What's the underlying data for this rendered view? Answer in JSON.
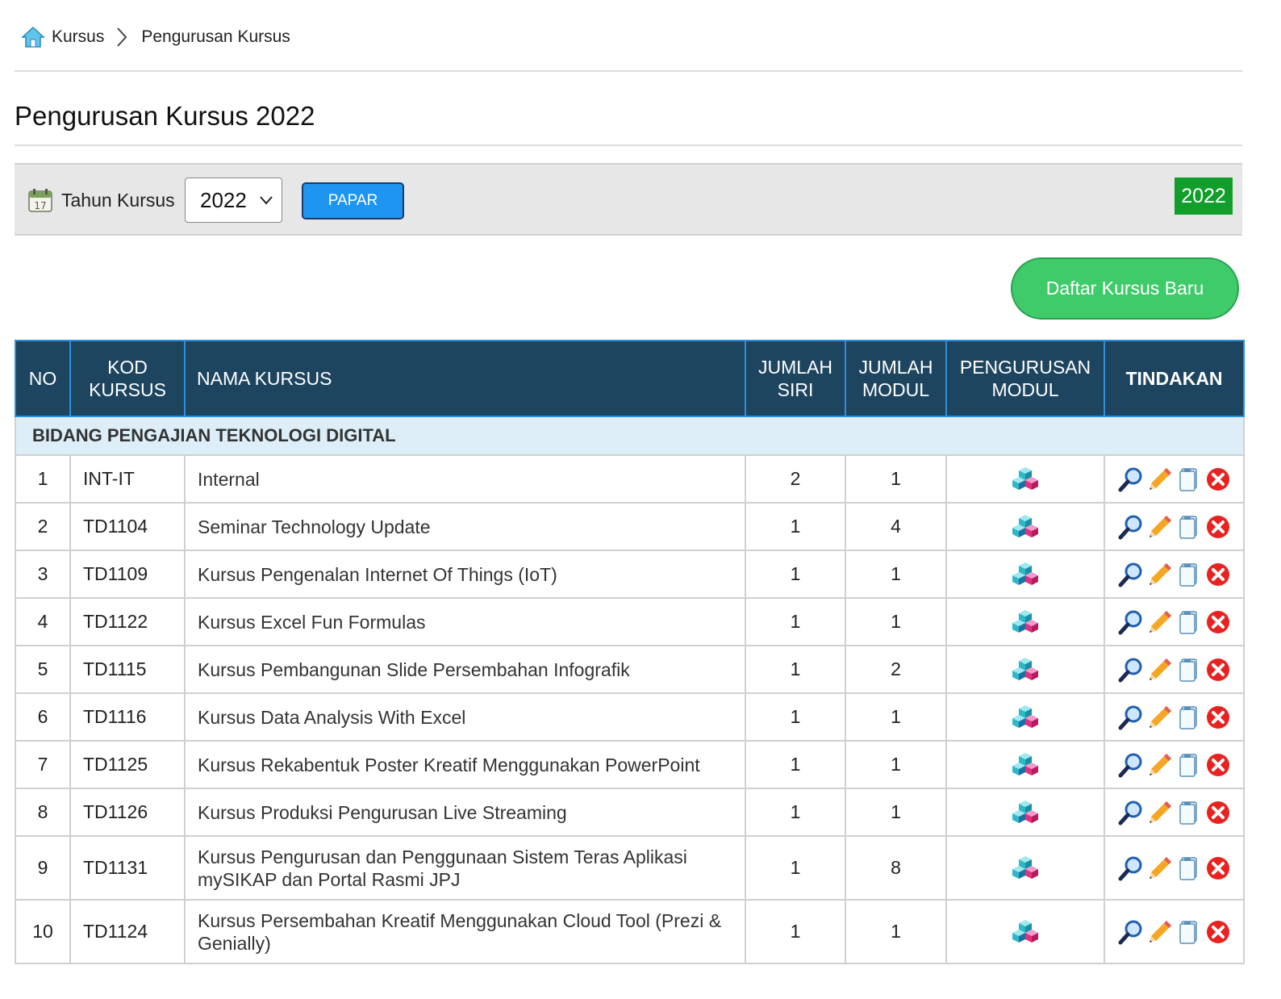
{
  "breadcrumb": {
    "home_label": "Kursus",
    "current": "Pengurusan Kursus"
  },
  "page_title": "Pengurusan Kursus 2022",
  "filter": {
    "label": "Tahun Kursus",
    "selected_year": "2022",
    "button_label": "PAPAR",
    "year_badge": "2022"
  },
  "new_course_button": "Daftar Kursus Baru",
  "table": {
    "headers": {
      "no": "NO",
      "kod": [
        "KOD",
        "KURSUS"
      ],
      "nama": "NAMA KURSUS",
      "siri": [
        "JUMLAH",
        "SIRI"
      ],
      "modul": [
        "JUMLAH",
        "MODUL"
      ],
      "pengurusan": [
        "PENGURUSAN",
        "MODUL"
      ],
      "tindakan": "TINDAKAN"
    },
    "group": "BIDANG PENGAJIAN TEKNOLOGI DIGITAL",
    "rows": [
      {
        "no": "1",
        "code": "INT-IT",
        "name": "Internal",
        "siri": "2",
        "modul": "1"
      },
      {
        "no": "2",
        "code": "TD1104",
        "name": "Seminar Technology Update",
        "siri": "1",
        "modul": "4"
      },
      {
        "no": "3",
        "code": "TD1109",
        "name": "Kursus Pengenalan Internet Of Things (IoT)",
        "siri": "1",
        "modul": "1"
      },
      {
        "no": "4",
        "code": "TD1122",
        "name": "Kursus Excel Fun Formulas",
        "siri": "1",
        "modul": "1"
      },
      {
        "no": "5",
        "code": "TD1115",
        "name": "Kursus Pembangunan Slide Persembahan Infografik",
        "siri": "1",
        "modul": "2"
      },
      {
        "no": "6",
        "code": "TD1116",
        "name": "Kursus Data Analysis With Excel",
        "siri": "1",
        "modul": "1"
      },
      {
        "no": "7",
        "code": "TD1125",
        "name": "Kursus Rekabentuk Poster Kreatif Menggunakan PowerPoint",
        "siri": "1",
        "modul": "1"
      },
      {
        "no": "8",
        "code": "TD1126",
        "name": "Kursus Produksi Pengurusan Live Streaming",
        "siri": "1",
        "modul": "1"
      },
      {
        "no": "9",
        "code": "TD1131",
        "name": "Kursus Pengurusan dan Penggunaan Sistem Teras Aplikasi mySIKAP dan Portal Rasmi JPJ",
        "siri": "1",
        "modul": "8"
      },
      {
        "no": "10",
        "code": "TD1124",
        "name": "Kursus Persembahan Kreatif Menggunakan Cloud Tool (Prezi & Genially)",
        "siri": "1",
        "modul": "1"
      }
    ],
    "row_icons": {
      "module": "cubes-icon",
      "actions": [
        "view-icon",
        "edit-icon",
        "copy-icon",
        "delete-icon"
      ]
    }
  },
  "colors": {
    "header_bg": "#1e4560",
    "header_border": "#2f8fd8",
    "group_bg": "#ddeef8",
    "papar_button": "#1e95f0",
    "year_badge": "#129e2a",
    "new_button": "#3fcb6a"
  }
}
